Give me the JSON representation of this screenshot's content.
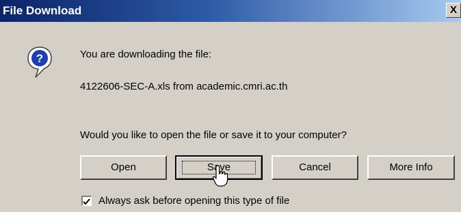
{
  "window": {
    "title": "File Download",
    "close_label": "X"
  },
  "message": {
    "line1": "You are downloading the file:",
    "line2": "4122606-SEC-A.xls from academic.cmri.ac.th",
    "question": "Would you like to open the file or save it to your computer?"
  },
  "buttons": {
    "open": "Open",
    "save": "Save",
    "cancel": "Cancel",
    "more_info": "More Info"
  },
  "checkbox": {
    "label": "Always ask before opening this type of file",
    "checked": true
  },
  "icons": {
    "question": "question-balloon-icon",
    "cursor": "hand-pointer-cursor-icon"
  },
  "colors": {
    "title_bar_start": "#0a246a",
    "title_bar_end": "#a6caf0",
    "dialog_bg": "#d4d0c8",
    "title_text": "#ffffff"
  }
}
